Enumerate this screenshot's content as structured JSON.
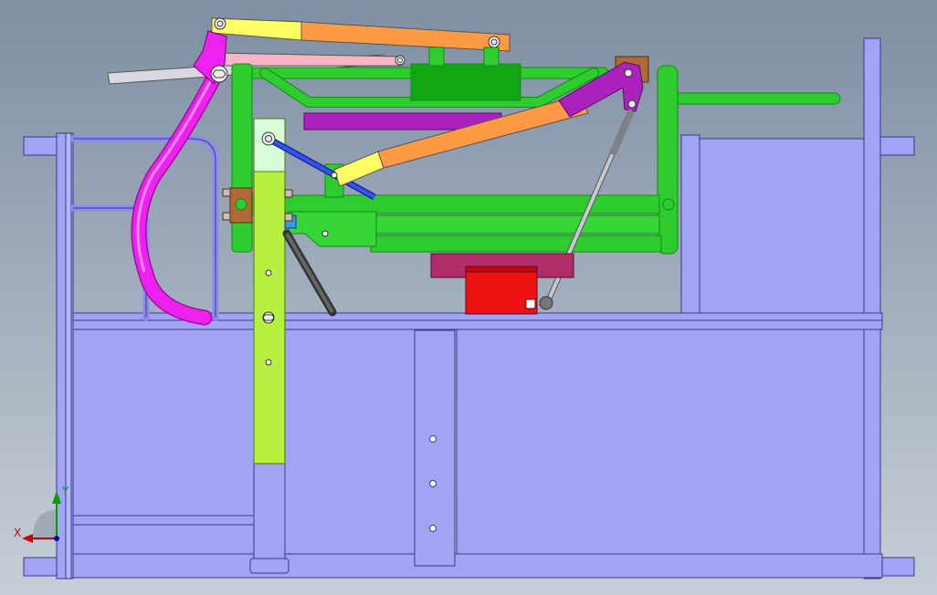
{
  "view": {
    "background_top": "#7e8fa3",
    "background_bottom": "#c7ced7"
  },
  "triad": {
    "x_label": "X",
    "y_label": "Y",
    "x_color": "#d00000",
    "y_color": "#00a000",
    "z_color": "#0000cc"
  },
  "colors": {
    "frame": "#a3a3f5",
    "frame_edge": "#3a3a8a",
    "green": "#2ecc2e",
    "green_dark": "#138a13",
    "lime": "#b8f040",
    "magenta": "#ee22ee",
    "purple": "#aa22bb",
    "orange": "#ff9a44",
    "yellow": "#ffff66",
    "pink": "#f6b6c6",
    "grey_link": "#d8d8e0",
    "red": "#ee1111",
    "maroon": "#b22e6a",
    "blue_link": "#2244cc",
    "gas_spring": "#c8c8d0",
    "dark_strut": "#444444",
    "brown": "#b06a3a"
  }
}
